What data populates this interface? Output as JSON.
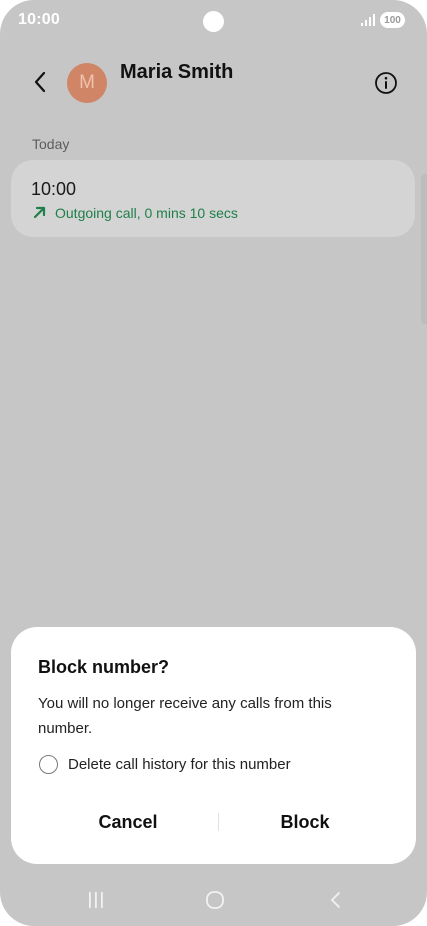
{
  "status_bar": {
    "time": "10:00",
    "battery": "100",
    "icons": [
      "camera-dot",
      "signal-icon",
      "battery-icon"
    ]
  },
  "header": {
    "avatar_initial": "M",
    "contact_name": "Maria Smith",
    "back_icon": "chevron-left-icon",
    "info_icon": "info-icon"
  },
  "call_log": {
    "section_label": "Today",
    "entries": [
      {
        "time": "10:00",
        "detail": "Outgoing call, 0 mins 10 secs",
        "icon": "outgoing-call-arrow-icon"
      }
    ]
  },
  "dialog": {
    "title": "Block number?",
    "message": "You will no longer receive any calls from this number.",
    "checkbox_label": "Delete call history for this number",
    "checkbox_checked": false,
    "cancel_label": "Cancel",
    "block_label": "Block"
  },
  "nav_bar": {
    "icons": [
      "recents-icon",
      "home-icon",
      "back-icon"
    ]
  },
  "colors": {
    "dim_background": "#c6c6c6",
    "avatar": "#cf8566",
    "outgoing_green": "#1f7f4a",
    "dialog_background": "#ffffff"
  }
}
